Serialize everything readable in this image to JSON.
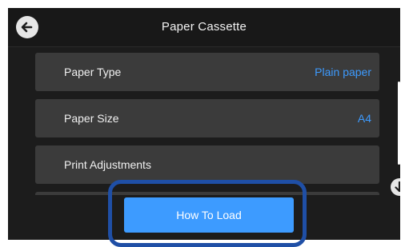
{
  "header": {
    "title": "Paper Cassette"
  },
  "items": [
    {
      "label": "Paper Type",
      "value": "Plain paper"
    },
    {
      "label": "Paper Size",
      "value": "A4"
    },
    {
      "label": "Print Adjustments",
      "value": ""
    }
  ],
  "footer": {
    "button_label": "How To Load"
  },
  "icons": {
    "back": "back-arrow-icon",
    "scroll_down": "arrow-down-icon"
  },
  "colors": {
    "accent": "#3d9bff",
    "highlight": "#1f4fa6",
    "item_bg": "#3b3b3b",
    "screen_bg": "#1c1c1c"
  }
}
